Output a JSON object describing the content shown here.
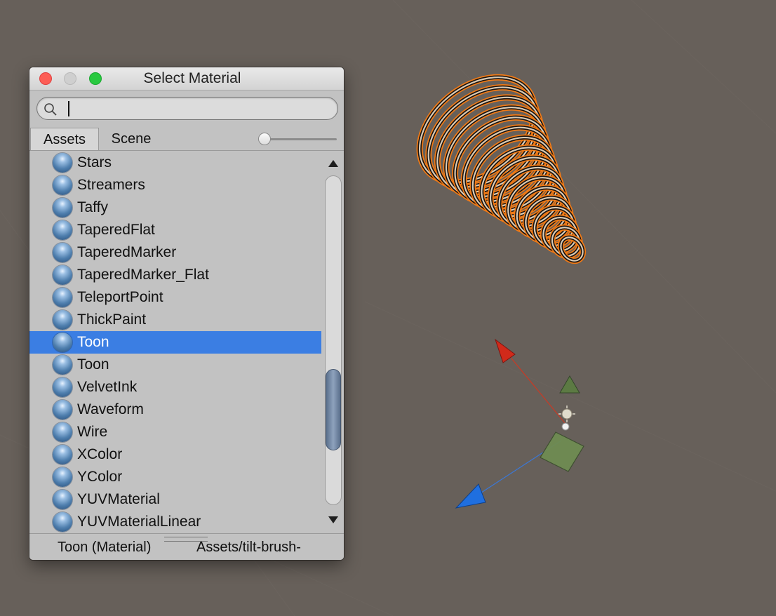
{
  "window": {
    "title": "Select Material"
  },
  "search": {
    "value": "",
    "placeholder": ""
  },
  "tabs": [
    {
      "label": "Assets",
      "active": true
    },
    {
      "label": "Scene",
      "active": false
    }
  ],
  "zoom_slider": {
    "level": 0.0
  },
  "list": {
    "items": [
      {
        "label": "Stars",
        "selected": false
      },
      {
        "label": "Streamers",
        "selected": false
      },
      {
        "label": "Taffy",
        "selected": false
      },
      {
        "label": "TaperedFlat",
        "selected": false
      },
      {
        "label": "TaperedMarker",
        "selected": false
      },
      {
        "label": "TaperedMarker_Flat",
        "selected": false
      },
      {
        "label": "TeleportPoint",
        "selected": false
      },
      {
        "label": "ThickPaint",
        "selected": false
      },
      {
        "label": "Toon",
        "selected": true
      },
      {
        "label": "Toon",
        "selected": false
      },
      {
        "label": "VelvetInk",
        "selected": false
      },
      {
        "label": "Waveform",
        "selected": false
      },
      {
        "label": "Wire",
        "selected": false
      },
      {
        "label": "XColor",
        "selected": false
      },
      {
        "label": "YColor",
        "selected": false
      },
      {
        "label": "YUVMaterial",
        "selected": false
      },
      {
        "label": "YUVMaterialLinear",
        "selected": false
      }
    ],
    "item_icon": "material-sphere-icon"
  },
  "scrollbar": {
    "position": 0.78
  },
  "status": {
    "selected_name": "Toon (Material)",
    "path": "Assets/tilt-brush-"
  },
  "colors": {
    "viewport_background": "#67605a",
    "selection": "#3b7ee3",
    "object_outline": "#f07a16",
    "gizmo_x": "#d02a1a",
    "gizmo_y": "#6b8e4e",
    "gizmo_z": "#1f6fe0"
  }
}
